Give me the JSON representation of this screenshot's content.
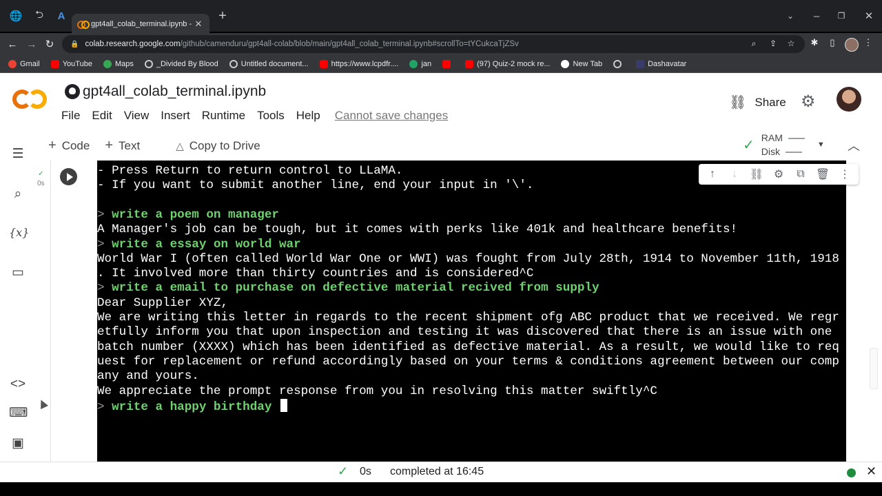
{
  "browser": {
    "tab_title": "gpt4all_colab_terminal.ipynb - Co",
    "url_domain": "colab.research.google.com",
    "url_path": "/github/camenduru/gpt4all-colab/blob/main/gpt4all_colab_terminal.ipynb#scrollTo=tYCukcaTjZSv",
    "bookmarks": [
      {
        "label": "Gmail",
        "color": "#ea4335"
      },
      {
        "label": "YouTube",
        "color": "#ff0000"
      },
      {
        "label": "Maps",
        "color": "#34a853"
      },
      {
        "label": "_Divided By Blood",
        "color": "#cccccc"
      },
      {
        "label": "Untitled document...",
        "color": "#cccccc"
      },
      {
        "label": "https://www.lcpdfr....",
        "color": "#ff0000"
      },
      {
        "label": "jan",
        "color": "#21a366"
      },
      {
        "label": "",
        "color": "#ff0000"
      },
      {
        "label": "(97) Quiz-2 mock re...",
        "color": "#ff0000"
      },
      {
        "label": "New Tab",
        "color": "#ffffff"
      },
      {
        "label": "",
        "color": "#cccccc"
      },
      {
        "label": "Dashavatar",
        "color": "#3b3b6b"
      }
    ]
  },
  "notebook": {
    "title": "gpt4all_colab_terminal.ipynb",
    "menu": [
      "File",
      "Edit",
      "View",
      "Insert",
      "Runtime",
      "Tools",
      "Help"
    ],
    "unsaved_notice": "Cannot save changes",
    "share_label": "Share",
    "toolbar": {
      "code": "Code",
      "text": "Text",
      "copy_to_drive": "Copy to Drive"
    },
    "resources": {
      "ram": "RAM",
      "disk": "Disk"
    },
    "cell_exec_time": "0s"
  },
  "terminal": {
    "lines": [
      {
        "text": "- Press Return to return control to LLaMA.",
        "kind": "out"
      },
      {
        "text": "- If you want to submit another line, end your input in '\\'.",
        "kind": "out"
      },
      {
        "text": "",
        "kind": "out"
      },
      {
        "text": "write a poem on manager",
        "kind": "prompt"
      },
      {
        "text": "A Manager's job can be tough, but it comes with perks like 401k and healthcare benefits!",
        "kind": "out"
      },
      {
        "text": "write a essay on world war",
        "kind": "prompt"
      },
      {
        "text": "World War I (often called World War One or WWI) was fought from July 28th, 1914 to November 11th, 1918",
        "kind": "out"
      },
      {
        "text": ". It involved more than thirty countries and is considered^C",
        "kind": "out"
      },
      {
        "text": "write a email to purchase on defective material recived from supply",
        "kind": "prompt"
      },
      {
        "text": "Dear Supplier XYZ,",
        "kind": "out"
      },
      {
        "text": "We are writing this letter in regards to the recent shipment ofg ABC product that we received. We regr",
        "kind": "out"
      },
      {
        "text": "etfully inform you that upon inspection and testing it was discovered that there is an issue with one",
        "kind": "out"
      },
      {
        "text": "batch number (XXXX) which has been identified as defective material. As a result, we would like to req",
        "kind": "out"
      },
      {
        "text": "uest for replacement or refund accordingly based on your terms & conditions agreement between our comp",
        "kind": "out"
      },
      {
        "text": "any and yours.",
        "kind": "out"
      },
      {
        "text": "We appreciate the prompt response from you in resolving this matter swiftly^C",
        "kind": "out"
      },
      {
        "text": "write a happy birthday",
        "kind": "prompt_active"
      }
    ],
    "prompt_marker": ">"
  },
  "status": {
    "time": "0s",
    "completed": "completed at 16:45"
  }
}
